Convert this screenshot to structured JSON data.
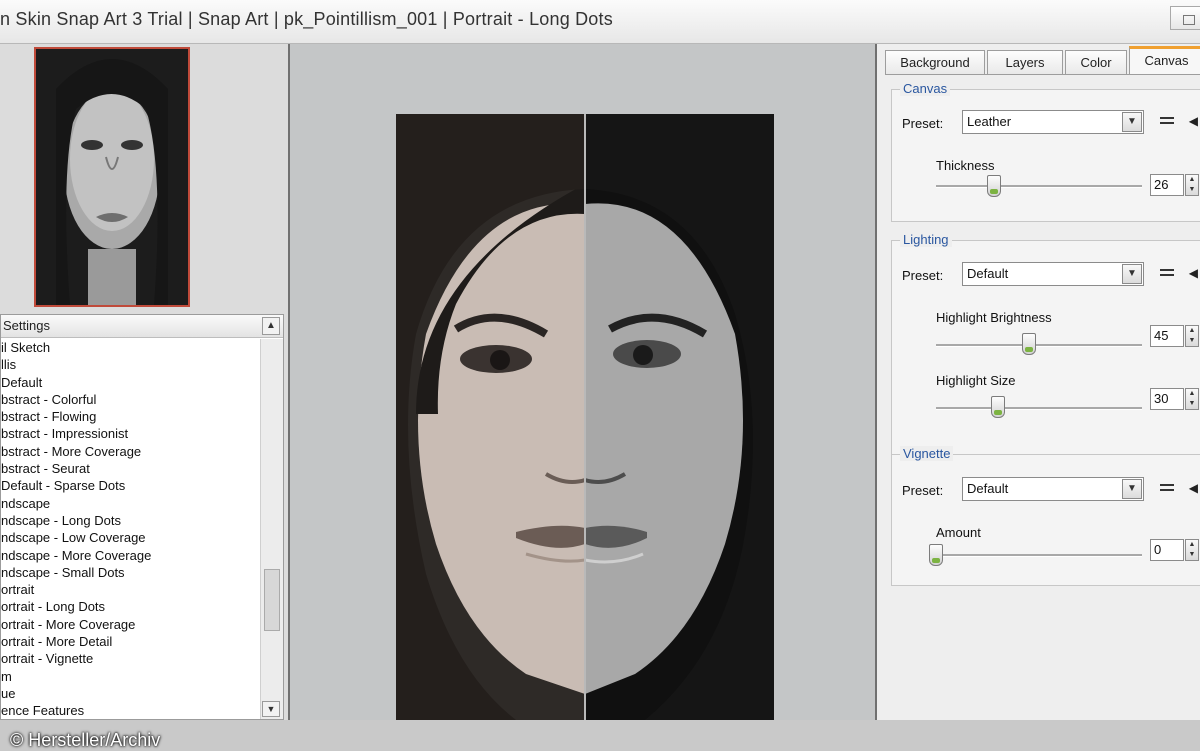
{
  "window": {
    "title": "n Skin Snap Art 3 Trial  |  Snap Art  |  pk_Pointillism_001  |  Portrait - Long Dots"
  },
  "settings_panel": {
    "header": "Settings",
    "items": [
      "il Sketch",
      "llis",
      "Default",
      "bstract - Colorful",
      "bstract - Flowing",
      "bstract - Impressionist",
      "bstract - More Coverage",
      "bstract - Seurat",
      "Default - Sparse Dots",
      "ndscape",
      "ndscape - Long Dots",
      "ndscape - Low Coverage",
      "ndscape - More Coverage",
      "ndscape - Small Dots",
      "ortrait",
      "ortrait - Long Dots",
      "ortrait - More Coverage",
      "ortrait - More Detail",
      "ortrait - Vignette",
      "m",
      "ue",
      "ence Features"
    ]
  },
  "watermark": "© Hersteller/Archiv",
  "tabs": [
    "Background",
    "Layers",
    "Color",
    "Canvas"
  ],
  "active_tab": "Canvas",
  "canvas_group": {
    "title": "Canvas",
    "preset_label": "Preset:",
    "preset_value": "Leather",
    "thickness_label": "Thickness",
    "thickness_value": "26",
    "thickness_level": 0.28
  },
  "lighting_group": {
    "title": "Lighting",
    "preset_label": "Preset:",
    "preset_value": "Default",
    "brightness_label": "Highlight Brightness",
    "brightness_value": "45",
    "brightness_level": 0.45,
    "size_label": "Highlight Size",
    "size_value": "30",
    "size_level": 0.3
  },
  "vignette_group": {
    "title": "Vignette",
    "preset_label": "Preset:",
    "preset_value": "Default",
    "amount_label": "Amount",
    "amount_value": "0",
    "amount_level": 0
  },
  "icons": {
    "window_button": "maximize-icon",
    "dropdown": "chevron-down-icon",
    "preset_menu": "preset-menu-icon",
    "collapse": "collapse-arrow-icon"
  }
}
